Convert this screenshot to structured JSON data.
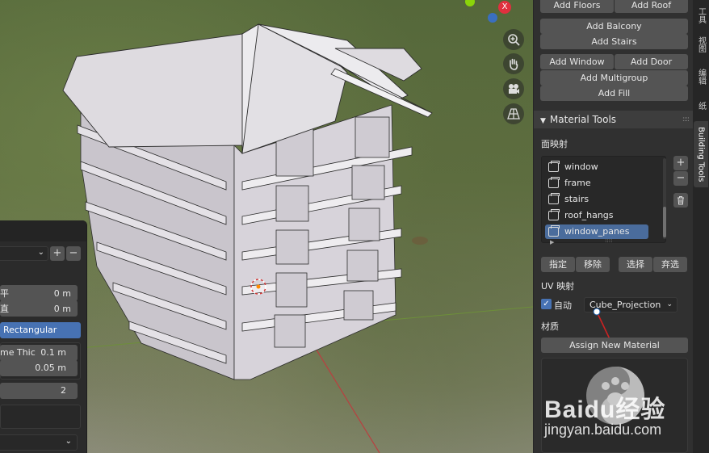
{
  "viewport": {
    "nav_icons": [
      "zoom-icon",
      "hand-pan-icon",
      "camera-icon",
      "grid-perspective-icon"
    ],
    "gizmo_x_label": "X"
  },
  "operator_panel": {
    "plus_label": "+",
    "minus_label": "−",
    "rows": [
      {
        "label": "平",
        "value": "0 m"
      },
      {
        "label": "直",
        "value": "0 m"
      }
    ],
    "frame_type": "Rectangular",
    "frame_thickness": {
      "label": "me Thic",
      "value": "0.1 m"
    },
    "frame_depth": {
      "value": "0.05 m"
    },
    "count": {
      "value": "2"
    }
  },
  "npanel": {
    "top_buttons": [
      [
        "Add Floors",
        "Add Roof"
      ],
      [
        "Add Balcony"
      ],
      [
        "Add Stairs"
      ],
      [
        "Add Window",
        "Add Door"
      ],
      [
        "Add Multigroup"
      ],
      [
        "Add Fill"
      ]
    ],
    "material_tools": {
      "title": "Material Tools",
      "face_map_label": "面映射",
      "face_maps": [
        "window",
        "frame",
        "stairs",
        "roof_hangs",
        "window_panes"
      ],
      "active_index": 4,
      "add_label": "+",
      "remove_label": "−",
      "assign_label": "指定",
      "remove_btn_label": "移除",
      "select_label": "选择",
      "deselect_label": "弃选",
      "uv_label": "UV 映射",
      "auto_label": "自动",
      "auto_checked": true,
      "projection": "Cube_Projection",
      "material_label": "材质",
      "assign_material_label": "Assign New Material"
    }
  },
  "tabs": [
    {
      "label": "工具",
      "active": false
    },
    {
      "label": "视图",
      "active": false
    },
    {
      "label": "编辑",
      "active": false
    },
    {
      "label": "纸",
      "active": false
    },
    {
      "label": "Building Tools",
      "active": true
    }
  ],
  "watermark": {
    "brand": "Baidu经验",
    "url": "jingyan.baidu.com"
  },
  "colors": {
    "accent_blue": "#4772b3",
    "active_item": "#4a6c9c",
    "panel_bg": "#303030",
    "button_bg": "#545454"
  }
}
